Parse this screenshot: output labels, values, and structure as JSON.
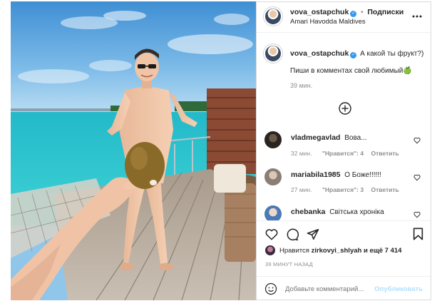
{
  "post": {
    "header": {
      "username": "vova_ostapchuk",
      "verified": true,
      "separator": "•",
      "follow_label": "Подписки",
      "location": "Amari Havodda Maldives",
      "more_icon": "more-horizontal-icon"
    },
    "caption": {
      "username": "vova_ostapchuk",
      "text_line1": "А какой ты фрукт?)",
      "text_line2": "Пиши в комментах свой любимый🍏",
      "time": "39 мин."
    },
    "load_more_icon": "plus-circle-icon",
    "comments": [
      {
        "username": "vladmegavlad",
        "text": "Вова...",
        "time": "32 мин.",
        "likes": "\"Нравится\": 4",
        "reply": "Ответить"
      },
      {
        "username": "mariabila1985",
        "text": "О Боже!!!!!!",
        "time": "27 мин.",
        "likes": "\"Нравится\": 3",
        "reply": "Ответить"
      },
      {
        "username": "chebanka",
        "text": "Світська хроніка",
        "time": "",
        "likes": "",
        "reply": ""
      }
    ],
    "actions": {
      "like_icon": "heart-icon",
      "comment_icon": "comment-icon",
      "share_icon": "paper-plane-icon",
      "save_icon": "bookmark-icon"
    },
    "likes_line": {
      "prefix": "Нравится ",
      "user": "zirkovyi_shlyah",
      "suffix": " и ещё 7 414"
    },
    "timestamp": "39 МИНУТ НАЗАД",
    "add_comment": {
      "emoji_icon": "smiley-icon",
      "placeholder": "Добавьте комментарий...",
      "publish_label": "Опубликовать"
    }
  },
  "colors": {
    "link_blue": "#3897f0",
    "publish_disabled": "#b2dffc",
    "text": "#262626",
    "muted": "#8e8e8e",
    "border": "#dbdbdb"
  }
}
